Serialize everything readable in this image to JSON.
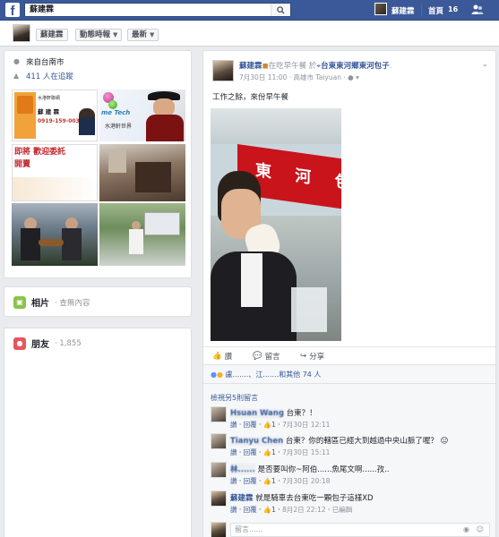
{
  "topbar": {
    "logo": "f",
    "search_value": "蘇建霖",
    "user_name": "蘇建霖",
    "home_label": "首頁",
    "home_count": "16"
  },
  "tabs": [
    {
      "label": "蘇建霖"
    },
    {
      "label": "動態時報",
      "caret": "▼"
    },
    {
      "label": "最新",
      "caret": "▼"
    }
  ],
  "intro": {
    "hometown": "來自台南市",
    "followers": "411 人在追蹤"
  },
  "photo_tiles": {
    "card_brand": "水港軒聯網",
    "card_name": "蘇 建 霖",
    "card_phone": "0919-159-003",
    "me_tech": "me Tech",
    "company": "水港軒世界",
    "banner_line1": "即將 歡迎委託",
    "banner_line2": "開賣"
  },
  "photos_card": {
    "title": "相片",
    "sub": "· 查無內容"
  },
  "friends_card": {
    "title": "朋友",
    "sub": "· 1,855"
  },
  "post": {
    "author": "蘇建霖",
    "activity": "在吃早午餐",
    "at": "於",
    "place": "台東東河鄉東河包子",
    "time": "7月30日 11:00",
    "location": "高雄市 Taiyuan",
    "text": "工作之餘，來份早午餐",
    "shop_sign": "東 河 包",
    "actions": {
      "like": "讚",
      "comment": "留言",
      "share": "分享"
    },
    "likes": "盧.......、江.......和其他 74 人",
    "more_comments": "檢視另5則留言"
  },
  "comments": [
    {
      "name": "Hsuan Wang",
      "text": "台東？！",
      "like": "讚",
      "reply": "回覆",
      "count": "1",
      "time": "7月30日 12:11"
    },
    {
      "name": "Tianyu Chen",
      "text": "台東？你的轄區已經大到越過中央山脈了喔？",
      "like": "讚",
      "reply": "回覆",
      "count": "1",
      "time": "7月30日 15:11"
    },
    {
      "name": "林......",
      "text": "是否要叫你~阿伯......魚尾文啊......孜..",
      "like": "讚",
      "reply": "回覆",
      "count": "1",
      "time": "7月30日 20:18"
    },
    {
      "name": "蘇建霖",
      "text": "就是騎車去台東吃一顆包子這樣XD",
      "like": "讚",
      "reply": "回覆",
      "count": "1",
      "time": "8月2日 22:12",
      "edited": "已編輯"
    }
  ],
  "compose": {
    "placeholder": "留言......"
  }
}
